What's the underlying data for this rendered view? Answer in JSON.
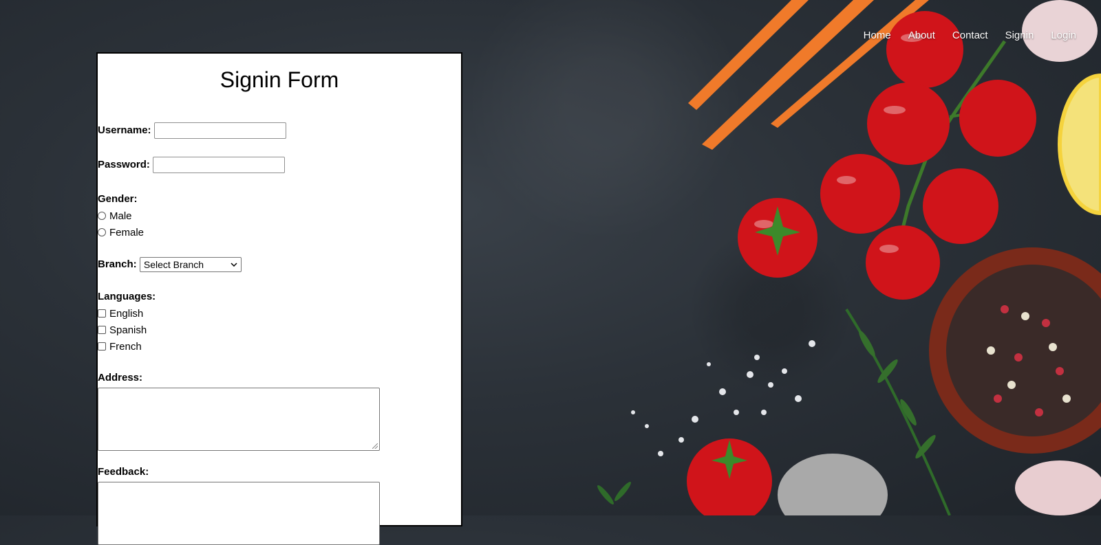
{
  "nav": {
    "items": [
      "Home",
      "About",
      "Contact",
      "Signin",
      "Login"
    ]
  },
  "form": {
    "title": "Signin Form",
    "username_label": "Username:",
    "username_value": "",
    "password_label": "Password:",
    "password_value": "",
    "gender_label": "Gender:",
    "gender_options": [
      "Male",
      "Female"
    ],
    "branch_label": "Branch:",
    "branch_selected": "Select Branch",
    "languages_label": "Languages:",
    "language_options": [
      "English",
      "Spanish",
      "French"
    ],
    "address_label": "Address:",
    "feedback_label": "Feedback:"
  },
  "colors": {
    "background": "#2b3138",
    "panel": "#ffffff",
    "nav_text": "#ffffff"
  }
}
